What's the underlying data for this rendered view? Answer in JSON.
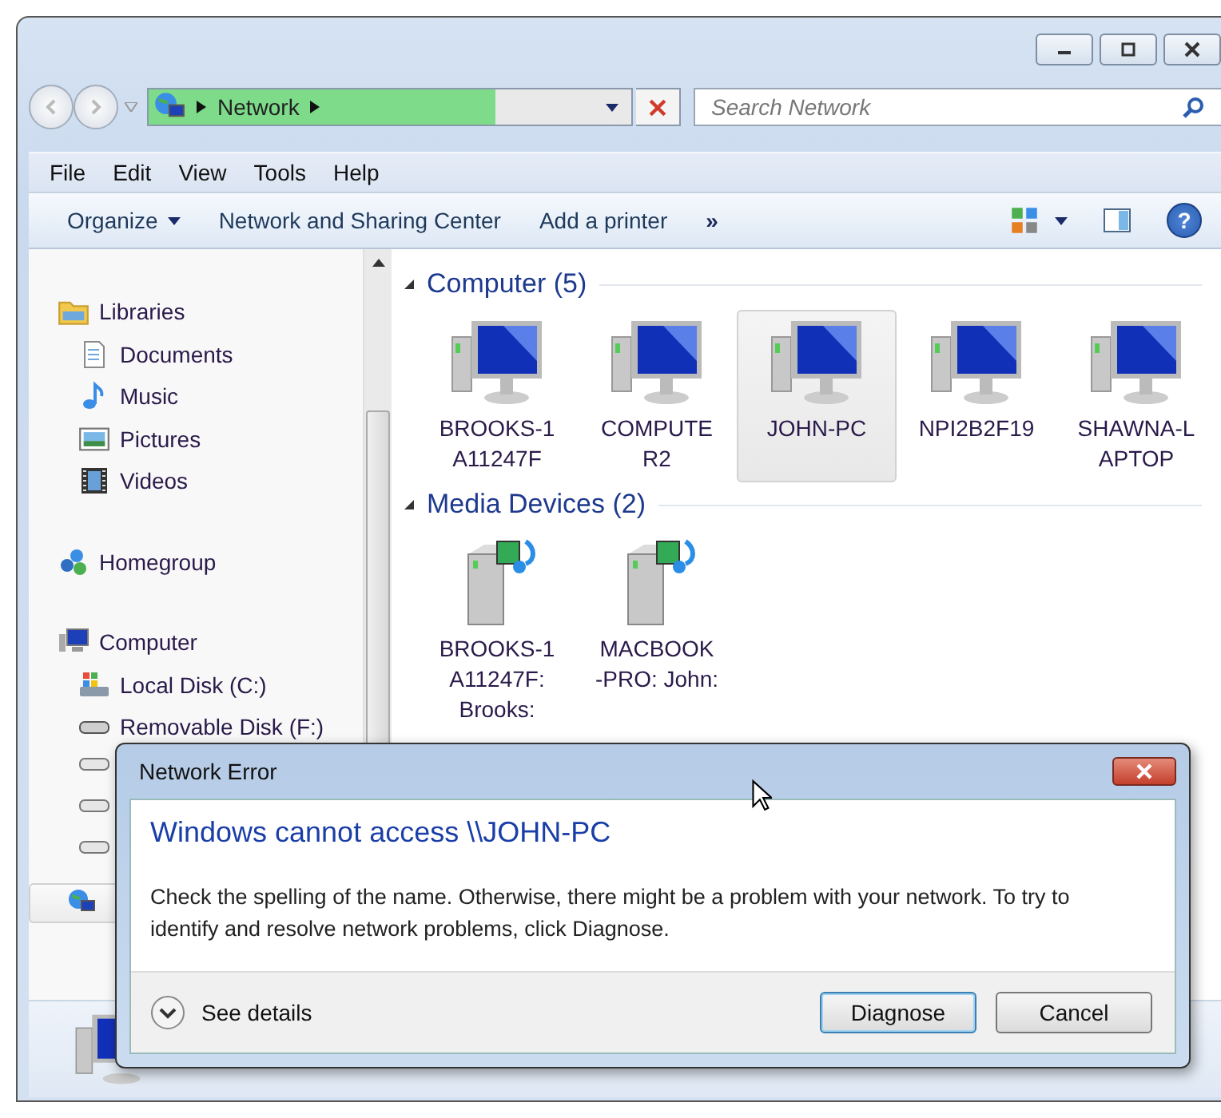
{
  "address": {
    "crumb": "Network",
    "level": 0.72
  },
  "search": {
    "placeholder": "Search Network"
  },
  "menu": [
    "File",
    "Edit",
    "View",
    "Tools",
    "Help"
  ],
  "commands": [
    {
      "label": "Organize",
      "kind": "dropdown"
    },
    {
      "label": "Network and Sharing Center",
      "kind": "plain"
    },
    {
      "label": "Add a printer",
      "kind": "plain"
    },
    {
      "label": "»",
      "kind": "more"
    }
  ],
  "help_button": "?",
  "sidebar": {
    "items": [
      {
        "label": "Libraries",
        "kind": "libraries",
        "selected": false,
        "children": [
          {
            "label": "Documents",
            "kind": "documents"
          },
          {
            "label": "Music",
            "kind": "music"
          },
          {
            "label": "Pictures",
            "kind": "pictures"
          },
          {
            "label": "Videos",
            "kind": "videos"
          }
        ]
      },
      {
        "label": "Homegroup",
        "kind": "homegroup",
        "selected": false
      },
      {
        "label": "Computer",
        "kind": "computer",
        "selected": false,
        "children": [
          {
            "label": "Local Disk (C:)",
            "kind": "localdisk"
          },
          {
            "label": "Removable Disk (F:)",
            "kind": "drive"
          }
        ]
      },
      {
        "kind": "network",
        "selected": true
      }
    ]
  },
  "groups": [
    {
      "title": "Computer (5)",
      "kind": "computer",
      "items": [
        {
          "label_lines": [
            "BROOKS-1",
            "A11247F"
          ],
          "selected": false
        },
        {
          "label_lines": [
            "COMPUTE",
            "R2"
          ],
          "selected": false
        },
        {
          "label_lines": [
            "JOHN-PC"
          ],
          "selected": true
        },
        {
          "label_lines": [
            "NPI2B2F19"
          ],
          "selected": false
        },
        {
          "label_lines": [
            "SHAWNA-L",
            "APTOP"
          ],
          "selected": false
        }
      ]
    },
    {
      "title": "Media Devices (2)",
      "kind": "media",
      "items": [
        {
          "label_lines": [
            "BROOKS-1",
            "A11247F:",
            "Brooks:"
          ],
          "selected": false
        },
        {
          "label_lines": [
            "MACBOOK",
            "-PRO: John:"
          ],
          "selected": false
        }
      ]
    }
  ],
  "dialog": {
    "title": "Network Error",
    "heading": "Windows cannot access \\\\JOHN-PC",
    "message": "Check the spelling of the name. Otherwise, there might be a problem with your network. To try to identify and resolve network problems, click Diagnose.",
    "details": "See details",
    "buttons": [
      {
        "label": "Diagnose",
        "default": true
      },
      {
        "label": "Cancel",
        "default": false
      }
    ]
  }
}
